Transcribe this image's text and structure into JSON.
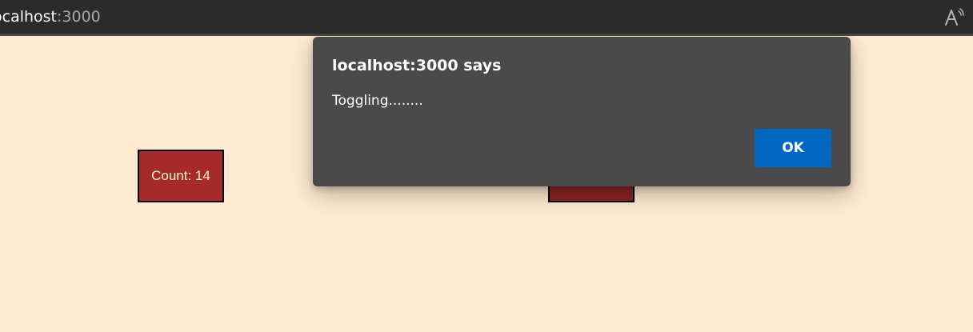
{
  "browser": {
    "url_host": "ocalhost",
    "url_port": ":3000",
    "read_aloud_icon": "read-aloud-icon"
  },
  "page": {
    "counter_label": "Count: 14",
    "background_color": "#ffebd0",
    "box_color": "#a52a2a"
  },
  "dialog": {
    "title": "localhost:3000 says",
    "message": "Toggling........",
    "ok_label": "OK",
    "background_color": "#4a4a4a",
    "button_color": "#0067c0"
  }
}
